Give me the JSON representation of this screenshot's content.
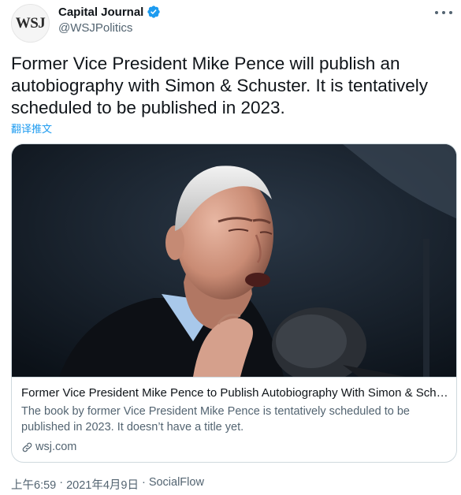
{
  "author": {
    "display_name": "Capital Journal",
    "handle": "@WSJPolitics",
    "avatar_text": "WSJ",
    "verified_icon": "verified-badge-icon"
  },
  "tweet": {
    "text": "Former Vice President Mike Pence will publish an autobiography with Simon & Schuster. It is tentatively scheduled to be published in 2023.",
    "translate_label": "翻译推文"
  },
  "card": {
    "title": "Former Vice President Mike Pence to Publish Autobiography With Simon & Schuster",
    "description": "The book by former Vice President Mike Pence is tentatively scheduled to be published in 2023. It doesn’t have a title yet.",
    "domain": "wsj.com"
  },
  "meta": {
    "time": "上午6:59",
    "separator1": "·",
    "date": "2021年4月9日",
    "separator2": "·",
    "source": "SocialFlow"
  },
  "colors": {
    "accent": "#1d9bf0",
    "secondary_text": "#536471",
    "border": "#cfd9de"
  }
}
